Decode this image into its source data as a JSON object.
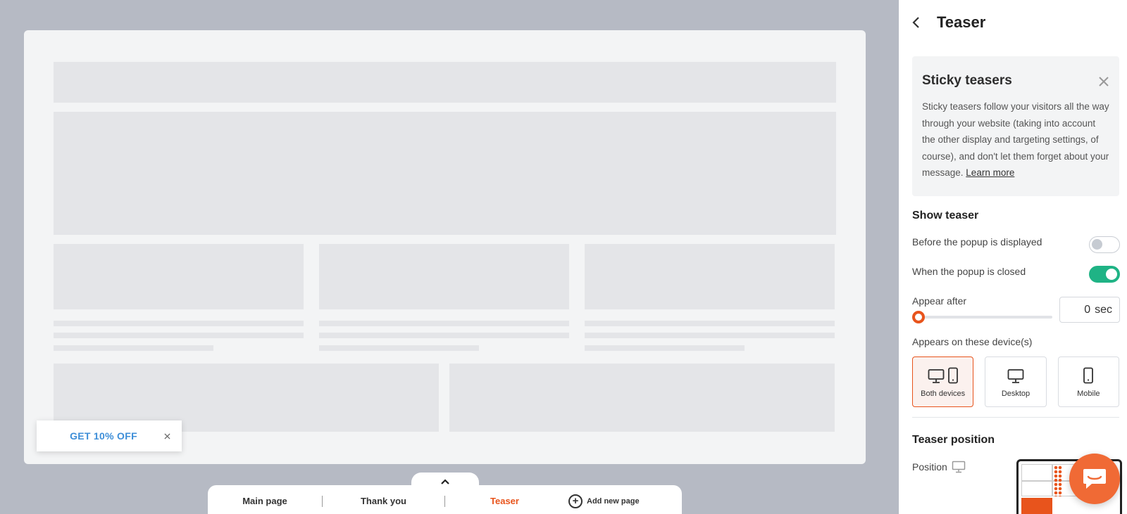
{
  "teaser_chip": {
    "label": "GET 10% OFF"
  },
  "page_tabs": {
    "items": [
      {
        "label": "Main page"
      },
      {
        "label": "Thank you"
      },
      {
        "label": "Teaser"
      }
    ],
    "active": "Teaser",
    "add_label": "Add new page"
  },
  "panel": {
    "title": "Teaser",
    "info": {
      "heading": "Sticky teasers",
      "body": "Sticky teasers follow your visitors all the way through your website (taking into account the other display and targeting settings, of course), and don't let them forget about your message.",
      "link": "Learn more"
    },
    "show_teaser": {
      "title": "Show teaser",
      "before_label": "Before the popup is displayed",
      "before_on": false,
      "after_label": "When the popup is closed",
      "after_on": true
    },
    "appear_after": {
      "label": "Appear after",
      "value": "0",
      "unit": "sec",
      "slider_fraction": 0
    },
    "devices": {
      "label": "Appears on these device(s)",
      "options": [
        {
          "label": "Both devices",
          "selected": true
        },
        {
          "label": "Desktop",
          "selected": false
        },
        {
          "label": "Mobile",
          "selected": false
        }
      ]
    },
    "position": {
      "title": "Teaser position",
      "label": "Position"
    }
  },
  "colors": {
    "accent": "#e8541c",
    "toggle_on": "#1fb385",
    "teaser_text": "#3d8ed8",
    "chat": "#f06a35"
  }
}
